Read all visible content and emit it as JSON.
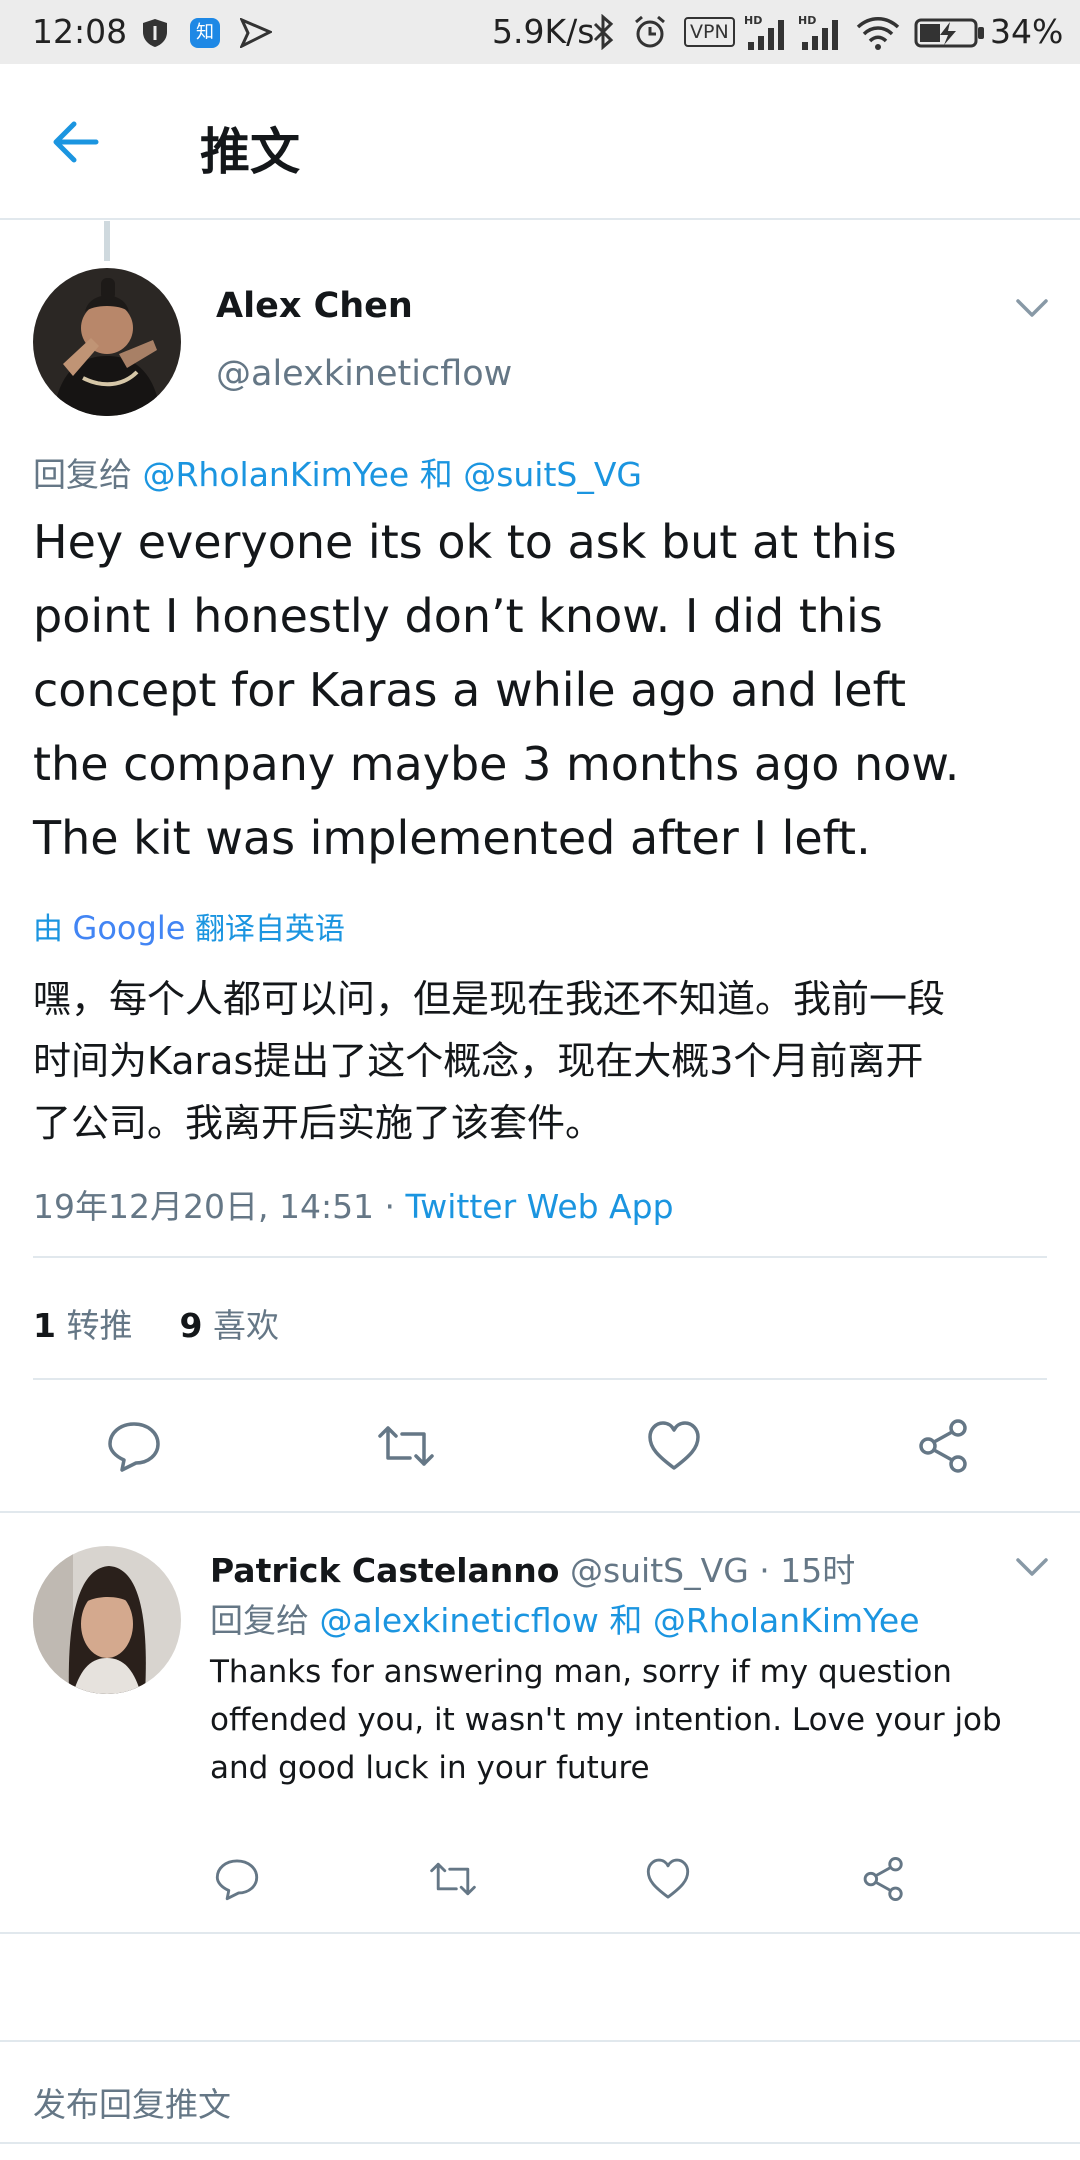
{
  "status_bar": {
    "time": "12:08",
    "net_speed": "5.9K/s",
    "vpn": "VPN",
    "battery": "34%"
  },
  "header": {
    "title": "推文"
  },
  "main_tweet": {
    "author_name": "Alex Chen",
    "author_handle": "@alexkineticflow",
    "reply_prefix": "回复给",
    "reply_to_1": "@RholanKimYee",
    "reply_and": "和",
    "reply_to_2": "@suitS_VG",
    "text_lines": [
      "Hey everyone its ok to ask but at this",
      "point I honestly don’t know. I did this",
      "concept for Karas a while ago and left",
      "the company maybe 3 months ago now.",
      "The kit was implemented after I left."
    ],
    "translated_by_prefix": "由",
    "translated_by_brand": "Google",
    "translated_by_suffix": "翻译自英语",
    "translation_lines": [
      "嘿，每个人都可以问，但是现在我还不知道。我前一段",
      "时间为Karas提出了这个概念，现在大概3个月前离开",
      "了公司。我离开后实施了该套件。"
    ],
    "timestamp": "19年12月20日, 14:51 · ",
    "source_app": "Twitter Web App",
    "retweet_count": "1",
    "retweet_label": "转推",
    "like_count": "9",
    "like_label": "喜欢"
  },
  "reply_tweet": {
    "author_name": "Patrick Castelanno",
    "meta": "@suitS_VG · 15时",
    "reply_prefix": "回复给",
    "reply_to_1": "@alexkineticflow",
    "reply_and": "和",
    "reply_to_2": "@RholanKimYee",
    "text_lines": [
      "Thanks for answering man, sorry if my question",
      "offended you, it wasn't my intention. Love your job",
      "and good luck in your future"
    ]
  },
  "composer": {
    "placeholder": "发布回复推文"
  },
  "colors": {
    "link_blue": "#1b95e0",
    "grey_text": "#657786",
    "divider": "#e1e8ed"
  },
  "icons": [
    "back-arrow-icon",
    "reply-icon",
    "retweet-icon",
    "like-icon",
    "share-icon",
    "chevron-down-icon"
  ]
}
